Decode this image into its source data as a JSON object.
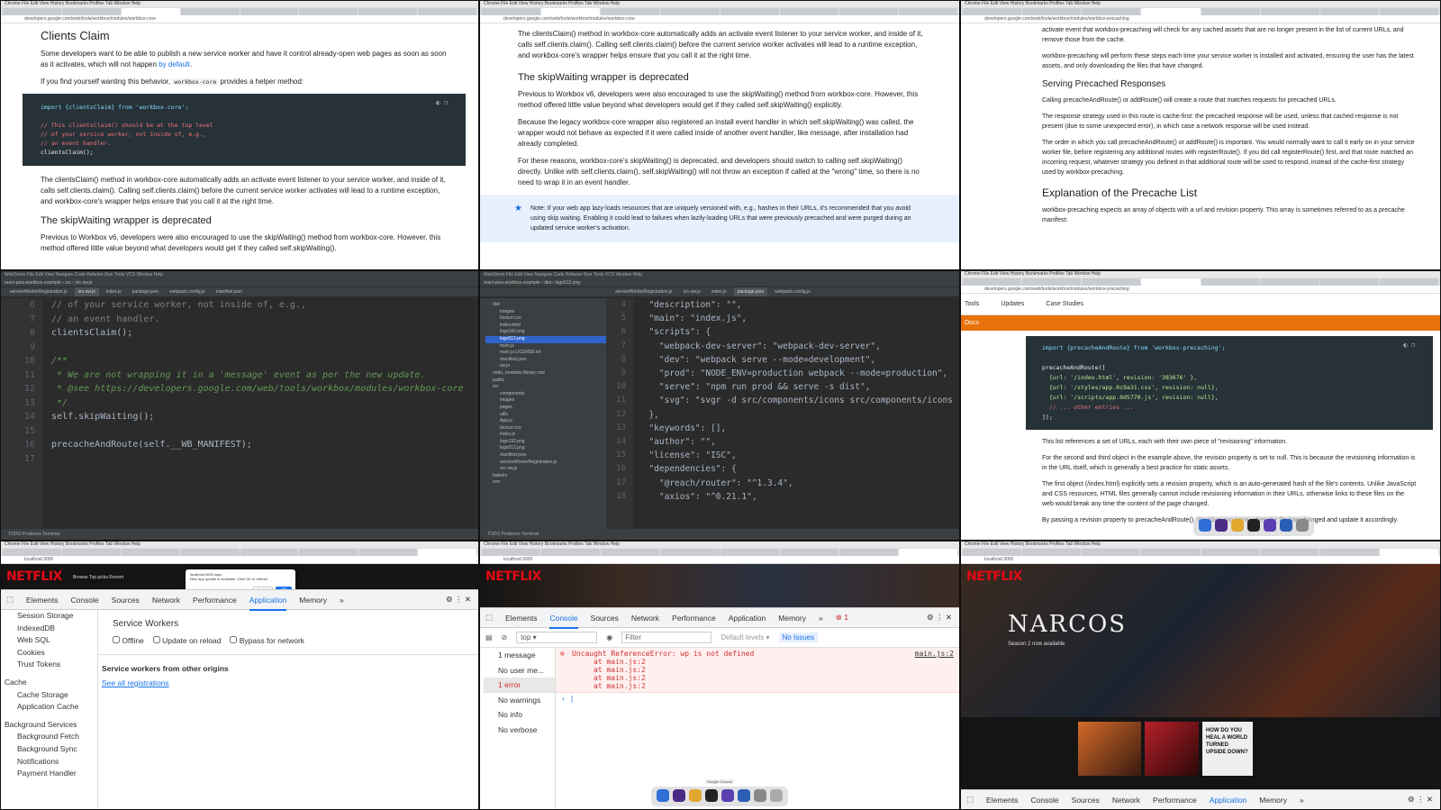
{
  "panel1": {
    "title": "Clients Claim",
    "p1": "Some developers want to be able to publish a new service worker and have it control already-open web pages as soon as soon as it activates, which will not happen",
    "p1_link": "by default",
    "p2": "If you find yourself wanting this behavior,",
    "p2_code": "workbox-core",
    "p2_end": "provides a helper method:",
    "code_lines": [
      "import {clientsClaim} from 'workbox-core';",
      "",
      "// This clientsClaim() should be at the top level",
      "// of your service worker, not inside of, e.g.,",
      "// an event handler.",
      "clientsClaim();"
    ],
    "p3": "The clientsClaim() method in workbox-core automatically adds an activate event listener to your service worker, and inside of it, calls self.clients.claim(). Calling self.clients.claim() before the current service worker activates will lead to a runtime exception, and workbox-core's wrapper helps ensure that you call it at the right time.",
    "h2": "The skipWaiting wrapper is deprecated",
    "p4": "Previous to Workbox v6, developers were also encouraged to use the skipWaiting() method from workbox-core. However, this method offered little value beyond what developers would get if they called self.skipWaiting()."
  },
  "panel2": {
    "p1": "The clientsClaim() method in workbox-core automatically adds an activate event listener to your service worker, and inside of it, calls self.clients.claim(). Calling self.clients.claim() before the current service worker activates will lead to a runtime exception, and workbox-core's wrapper helps ensure that you call it at the right time.",
    "h2": "The skipWaiting wrapper is deprecated",
    "p2": "Previous to Workbox v6, developers were also encouraged to use the skipWaiting() method from workbox-core. However, this method offered little value beyond what developers would get if they called self.skipWaiting() explicitly.",
    "p3": "Because the legacy workbox-core wrapper also registered an install event handler in which self.skipWaiting() was called, the wrapper would not behave as expected if it were called inside of another event handler, like message, after installation had already completed.",
    "p4": "For these reasons, workbox-core's skipWaiting() is deprecated, and developers should switch to calling self.skipWaiting() directly. Unlike with self.clients.claim(), self.skipWaiting() will not throw an exception if called at the \"wrong\" time, so there is no need to wrap it in an event handler.",
    "note": "Note: If your web app lazy-loads resources that are uniquely versioned with, e.g., hashes in their URLs, it's recommended that you avoid using skip waiting. Enabling it could lead to failures when lazily-loading URLs that were previously precached and were purged during an updated service worker's activation."
  },
  "panel3": {
    "p1": "activate event that workbox-precaching will check for any cached assets that are no longer present in the list of current URLs, and remove those from the cache.",
    "p2": "workbox-precaching will perform these steps each time your service worker is installed and activated, ensuring the user has the latest assets, and only downloading the files that have changed.",
    "h3": "Serving Precached Responses",
    "p3": "Calling precacheAndRoute() or addRoute() will create a route that matches requests for precached URLs.",
    "p4": "The response strategy used in this route is cache-first: the precached response will be used, unless that cached response is not present (due to some unexpected error), in which case a network response will be used instead.",
    "p5": "The order in which you call precacheAndRoute() or addRoute() is important. You would normally want to call it early on in your service worker file, before registering any additional routes with registerRoute(). If you did call registerRoute() first, and that route matched an incoming request, whatever strategy you defined in that additional route will be used to respond, instead of the cache-first strategy used by workbox-precaching.",
    "h2": "Explanation of the Precache List",
    "p6": "workbox-precaching expects an array of objects with a url and revision property. This array is sometimes referred to as a precache manifest:"
  },
  "panel4": {
    "project": "react-pwa-workbox-example",
    "tabs": [
      "serviceWorkerRegistration.js",
      "src-sw.js",
      "index.js",
      "package.json",
      "webpack.config.js",
      "manifest.json"
    ],
    "gutter": [
      "6",
      "7",
      "8",
      "9",
      "10",
      "11",
      "12",
      "13",
      "14",
      "15",
      "16",
      "17"
    ],
    "code": [
      " // of your service worker, not inside of, e.g.,",
      " // an event handler.",
      " clientsClaim();",
      "",
      " /**",
      "  * We are not wrapping it in a 'message' event as per the new update.",
      "  * @see https://developers.google.com/web/tools/workbox/modules/workbox-core",
      "  */",
      " self.skipWaiting();",
      "",
      " precacheAndRoute(self.__WB_MANIFEST);",
      ""
    ],
    "status": "TODO   Problems   Terminal"
  },
  "panel5": {
    "project": "react-pwa-workbox-example",
    "tree": [
      "dist",
      "images",
      "favicon.ico",
      "index.html",
      "logo192.png",
      "logo512.png",
      "main.js",
      "main.js.LICENSE.txt",
      "manifest.json",
      "sw.js",
      "node_modules  library root",
      "public",
      "src",
      "components",
      "images",
      "pages",
      "utils",
      "App.js",
      "favicon.ico",
      "index.js",
      "logo192.png",
      "logo512.png",
      "manifest.json",
      "serviceWorkerRegistration.js",
      "src-sw.js",
      "babelrc",
      "env"
    ],
    "gutter": [
      "4",
      "5",
      "6",
      "7",
      "8",
      "9",
      "10",
      "11",
      "12",
      "13",
      "14",
      "15",
      "16",
      "17",
      "18"
    ],
    "code": [
      "  \"description\": \"\",",
      "  \"main\": \"index.js\",",
      "  \"scripts\": {",
      "    \"webpack-dev-server\": \"webpack-dev-server\",",
      "    \"dev\": \"webpack serve --mode=development\",",
      "    \"prod\": \"NODE_ENV=production webpack --mode=production\",",
      "    \"serve\": \"npm run prod && serve -s dist\",",
      "    \"svg\": \"svgr -d src/components/icons src/components/icons",
      "  },",
      "  \"keywords\": [],",
      "  \"author\": \"\",",
      "  \"license\": \"ISC\",",
      "  \"dependencies\": {",
      "    \"@reach/router\": \"^1.3.4\",",
      "    \"axios\": \"^0.21.1\","
    ]
  },
  "panel6": {
    "nav": [
      "Tools",
      "Updates",
      "Case Studies"
    ],
    "docs": "Docs",
    "code": [
      "import {precacheAndRoute} from 'workbox-precaching';",
      "",
      "precacheAndRoute([",
      "  {url: '/index.html', revision: '383676' },",
      "  {url: '/styles/app.0c9a31.css', revision: null},",
      "  {url: '/scripts/app.0d5770.js', revision: null},",
      "  // ... other entries ...",
      "]);"
    ],
    "p1": "This list references a set of URLs, each with their own piece of \"revisioning\" information.",
    "p2": "For the second and third object in the example above, the revision property is set to null. This is because the revisioning information is in the URL itself, which is generally a best practice for static assets.",
    "p3": "The first object (/index.html) explicitly sets a revision property, which is an auto-generated hash of the file's contents. Unlike JavaScript and CSS resources, HTML files generally cannot include revisioning information in their URLs, otherwise links to these files on the web would break any time the content of the page changed.",
    "p4": "By passing a revision property to precacheAndRoute(), Workbox can know when the file has changed and update it accordingly."
  },
  "panel7": {
    "logo": "NETFLIX",
    "dialog_host": "localhost:3000 says",
    "dialog_msg": "New app update is available. Click OK to refresh",
    "dialog_cancel": "Cancel",
    "dialog_ok": "OK",
    "tabs": [
      "Elements",
      "Console",
      "Sources",
      "Network",
      "Performance",
      "Application",
      "Memory",
      "»"
    ],
    "sidebar_storage": [
      "Session Storage",
      "IndexedDB",
      "Web SQL",
      "Cookies",
      "Trust Tokens"
    ],
    "cache_header": "Cache",
    "sidebar_cache": [
      "Cache Storage",
      "Application Cache"
    ],
    "bg_header": "Background Services",
    "sidebar_bg": [
      "Background Fetch",
      "Background Sync",
      "Notifications",
      "Payment Handler"
    ],
    "sw_title": "Service Workers",
    "opt_offline": "Offline",
    "opt_update": "Update on reload",
    "opt_bypass": "Bypass for network",
    "other_origins": "Service workers from other origins",
    "see_all": "See all registrations"
  },
  "panel8": {
    "logo": "NETFLIX",
    "tabs": [
      "Elements",
      "Console",
      "Sources",
      "Network",
      "Performance",
      "Application",
      "Memory",
      "»"
    ],
    "error_count": "1",
    "context": "top",
    "filter_placeholder": "Filter",
    "levels": "Default levels ▾",
    "no_issues": "No Issues",
    "side": [
      "1 message",
      "No user me...",
      "1 error",
      "No warnings",
      "No info",
      "No verbose"
    ],
    "error": "Uncaught ReferenceError: wp is not defined",
    "error_src": "main.js:2",
    "stack": [
      "at main.js:2",
      "at main.js:2",
      "at main.js:2",
      "at main.js:2"
    ],
    "dock_label": "Google Chrome"
  },
  "panel9": {
    "logo": "NETFLIX",
    "hero_title": "NARCOS",
    "hero_sub": "Season 2 now available",
    "poster_text": "HOW DO YOU HEAL A WORLD TURNED UPSIDE DOWN?",
    "tabs": [
      "Elements",
      "Console",
      "Sources",
      "Network",
      "Performance",
      "Application",
      "Memory",
      "»"
    ]
  }
}
